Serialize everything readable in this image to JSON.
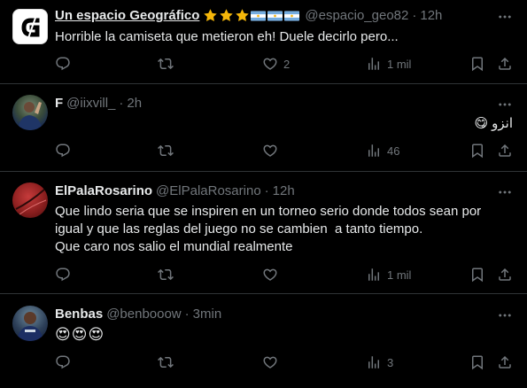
{
  "colors": {
    "background": "#000000",
    "text": "#e7e9ea",
    "muted": "#71767b",
    "divider": "#2f3336",
    "star": "#f5b70a"
  },
  "posts": [
    {
      "author": "Un espacio Geográfico",
      "handle": "@espacio_geo82",
      "separator": "·",
      "time": "12h",
      "text": "Horrible la camiseta que metieron eh! Duele decirlo pero...",
      "badges": [
        "star-icon",
        "star-icon",
        "star-icon",
        "argentina-flag-icon",
        "argentina-flag-icon",
        "argentina-flag-icon"
      ],
      "likes": "2",
      "views": "1 mil"
    },
    {
      "author": "F",
      "handle": "@iixvill_",
      "separator": "·",
      "time": "2h",
      "text": "انزو",
      "emoji": "😋",
      "views": "46"
    },
    {
      "author": "ElPalaRosarino",
      "handle": "@ElPalaRosarino",
      "separator": "·",
      "time": "12h",
      "text_lines": [
        "Que lindo seria que se inspiren en un torneo serio donde todos sean por",
        "igual y que las reglas del juego no se cambien  a tanto tiempo.",
        "Que caro nos salio el mundial realmente"
      ],
      "views": "1 mil"
    },
    {
      "author": "Benbas",
      "handle": "@benbooow",
      "separator": "·",
      "time": "3min",
      "emoji": "😍😍😍",
      "views": "3"
    }
  ]
}
